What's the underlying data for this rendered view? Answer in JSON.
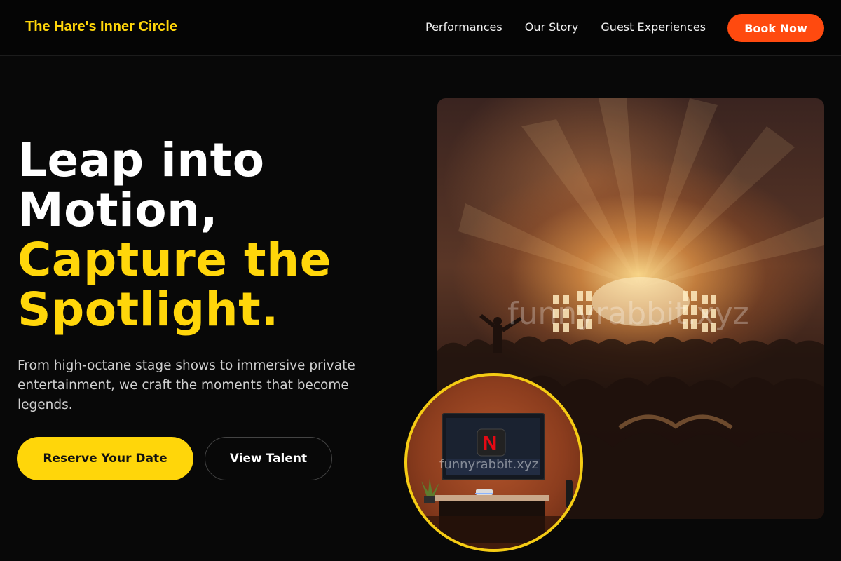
{
  "header": {
    "brand": "The Hare's Inner Circle",
    "nav": [
      "Performances",
      "Our Story",
      "Guest Experiences"
    ],
    "cta": "Book Now"
  },
  "hero": {
    "headline_white": [
      "Leap into",
      "Motion,"
    ],
    "headline_yellow": [
      "Capture the",
      "Spotlight."
    ],
    "subtext": "From high-octane stage shows to immersive private entertainment, we craft the moments that become legends.",
    "primary_button": "Reserve Your Date",
    "secondary_button": "View Talent"
  },
  "images": {
    "concert_watermark": "funnyrabbit.xyz",
    "tv_watermark": "funnyrabbit.xyz",
    "tv_logo": "N"
  },
  "colors": {
    "accent_yellow": "#ffd60a",
    "cta_orange": "#ff4a0f",
    "background": "#080808"
  }
}
